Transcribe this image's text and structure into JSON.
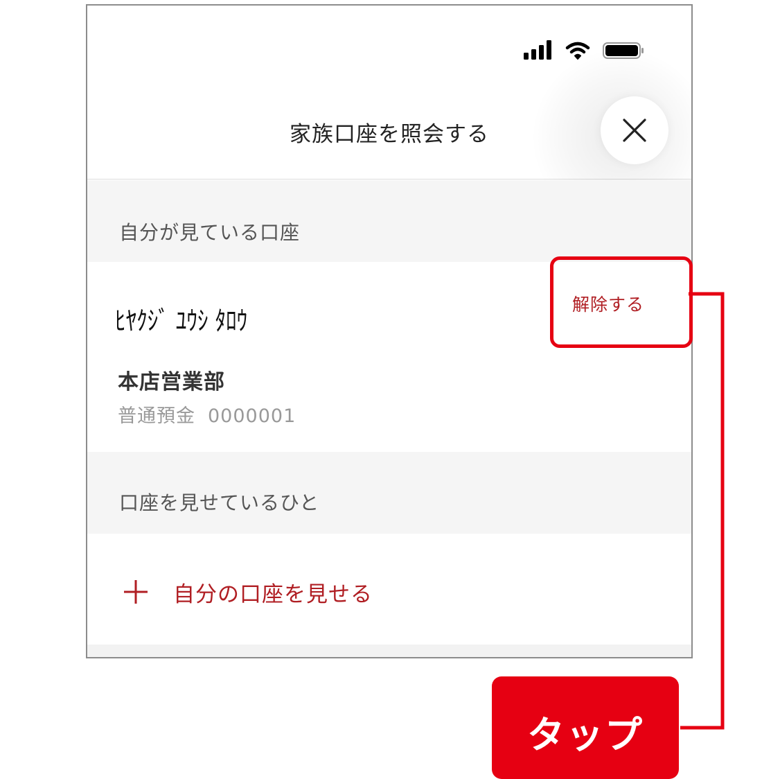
{
  "status_bar": {
    "icons": [
      "signal-icon",
      "wifi-icon",
      "battery-icon"
    ]
  },
  "header": {
    "title": "家族口座を照会する",
    "close_icon": "close-icon"
  },
  "viewing_section": {
    "label": "自分が見ている口座",
    "account": {
      "holder_name": "ﾋﾔｸｼﾞ ﾕｳｼ ﾀﾛｳ",
      "release_label": "解除する",
      "branch": "本店営業部",
      "type": "普通預金",
      "number": "0000001"
    }
  },
  "sharing_section": {
    "label": "口座を見せているひと",
    "add_label": "自分の口座を見せる",
    "add_icon": "plus-icon"
  },
  "annotation": {
    "tap_label": "タップ",
    "color": "#e60012"
  },
  "colors": {
    "accent": "#b01e23",
    "section_bg": "#f5f5f5",
    "annotation": "#e60012"
  }
}
